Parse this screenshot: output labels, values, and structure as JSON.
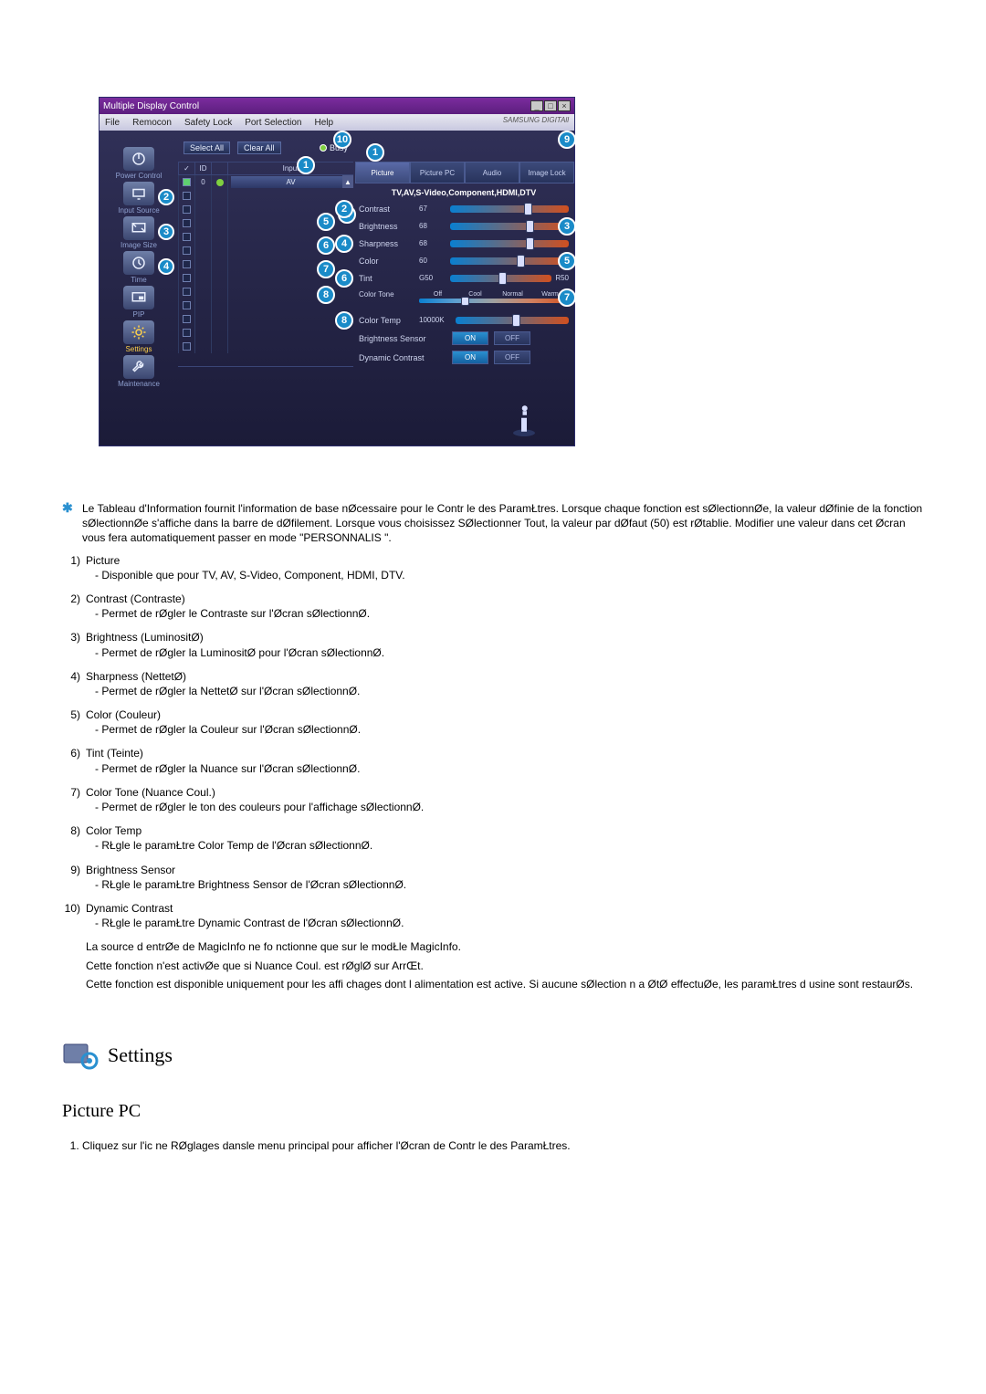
{
  "window": {
    "title": "Multiple Display Control",
    "menu": [
      "File",
      "Remocon",
      "Safety Lock",
      "Port Selection",
      "Help"
    ],
    "brand": "SAMSUNG DIGITAll"
  },
  "sidebar": {
    "items": [
      {
        "label": "Power Control"
      },
      {
        "label": "Input Source"
      },
      {
        "label": "Image Size"
      },
      {
        "label": "Time"
      },
      {
        "label": "PIP"
      },
      {
        "label": "Settings"
      },
      {
        "label": "Maintenance"
      }
    ]
  },
  "center": {
    "select_all": "Select All",
    "clear_all": "Clear All",
    "busy": "Busy",
    "head_id": "ID",
    "head_input": "Input",
    "row0_id": "0",
    "row0_input": "AV"
  },
  "right": {
    "tabs": {
      "picture": "Picture",
      "picture_pc": "Picture PC",
      "audio": "Audio",
      "image_lock": "Image Lock"
    },
    "subtitle": "TV,AV,S-Video,Component,HDMI,DTV",
    "contrast": {
      "label": "Contrast",
      "val": "67"
    },
    "brightness": {
      "label": "Brightness",
      "val": "68"
    },
    "sharpness": {
      "label": "Sharpness",
      "val": "68"
    },
    "color": {
      "label": "Color",
      "val": "60"
    },
    "tint": {
      "label": "Tint",
      "val": "G50",
      "r": "R50"
    },
    "color_tone": {
      "label": "Color Tone",
      "opts": [
        "Off",
        "Cool",
        "Normal",
        "Warm"
      ]
    },
    "color_temp": {
      "label": "Color Temp",
      "val": "10000K"
    },
    "bsensor": {
      "label": "Brightness Sensor",
      "on": "ON",
      "off": "OFF"
    },
    "dcontrast": {
      "label": "Dynamic Contrast",
      "on": "ON",
      "off": "OFF"
    }
  },
  "doc": {
    "star": "Le Tableau d'Information fournit l'information de base nØcessaire pour le Contr le des ParamŁtres. Lorsque chaque fonction est sØlectionnØe, la valeur dØfinie de la fonction sØlectionnØe s'affiche dans la barre de dØfilement. Lorsque vous choisissez SØlectionner Tout, la valeur par dØfaut (50) est rØtablie. Modifier une valeur dans cet Øcran vous fera automatiquement passer en mode \"PERSONNALIS \".",
    "items": [
      {
        "n": "1)",
        "t": "Picture",
        "d": "- Disponible que pour TV, AV, S-Video, Component, HDMI, DTV."
      },
      {
        "n": "2)",
        "t": "Contrast (Contraste)",
        "d": "- Permet de rØgler le Contraste sur l'Øcran sØlectionnØ."
      },
      {
        "n": "3)",
        "t": "Brightness (LuminositØ)",
        "d": "- Permet de rØgler la LuminositØ pour l'Øcran sØlectionnØ."
      },
      {
        "n": "4)",
        "t": "Sharpness (NettetØ)",
        "d": "- Permet de rØgler la NettetØ sur l'Øcran sØlectionnØ."
      },
      {
        "n": "5)",
        "t": "Color (Couleur)",
        "d": "- Permet de rØgler la Couleur sur l'Øcran sØlectionnØ."
      },
      {
        "n": "6)",
        "t": "Tint (Teinte)",
        "d": "- Permet de rØgler la Nuance sur l'Øcran sØlectionnØ."
      },
      {
        "n": "7)",
        "t": "Color Tone (Nuance Coul.)",
        "d": "- Permet de rØgler le ton des couleurs pour l'affichage sØlectionnØ."
      },
      {
        "n": "8)",
        "t": "Color Temp",
        "d": "- RŁgle le paramŁtre Color Temp de l'Øcran sØlectionnØ."
      },
      {
        "n": "9)",
        "t": "Brightness Sensor",
        "d": "- RŁgle le paramŁtre Brightness Sensor de l'Øcran sØlectionnØ."
      },
      {
        "n": "10)",
        "t": "Dynamic Contrast",
        "d": "- RŁgle le paramŁtre Dynamic Contrast de l'Øcran sØlectionnØ."
      }
    ],
    "p1": "La source d entrØe de MagicInfo ne fo       nctionne que sur le modŁle MagicInfo.",
    "p2": "Cette fonction n'est activØe que si Nuance Coul. est rØglØ sur ArrŒt.",
    "p3": "Cette fonction est disponible uniquement pour les affi           chages dont l alimentation est active. Si aucune sØlection n a ØtØ effectuØe, les paramŁtres d usine sont restaurØs.",
    "settings": "Settings",
    "picture_pc": "Picture PC",
    "ordered1": "Cliquez sur l'ic ne RØglages dansle menu principal pour afficher l'Øcran de Contr le des ParamŁtres."
  }
}
